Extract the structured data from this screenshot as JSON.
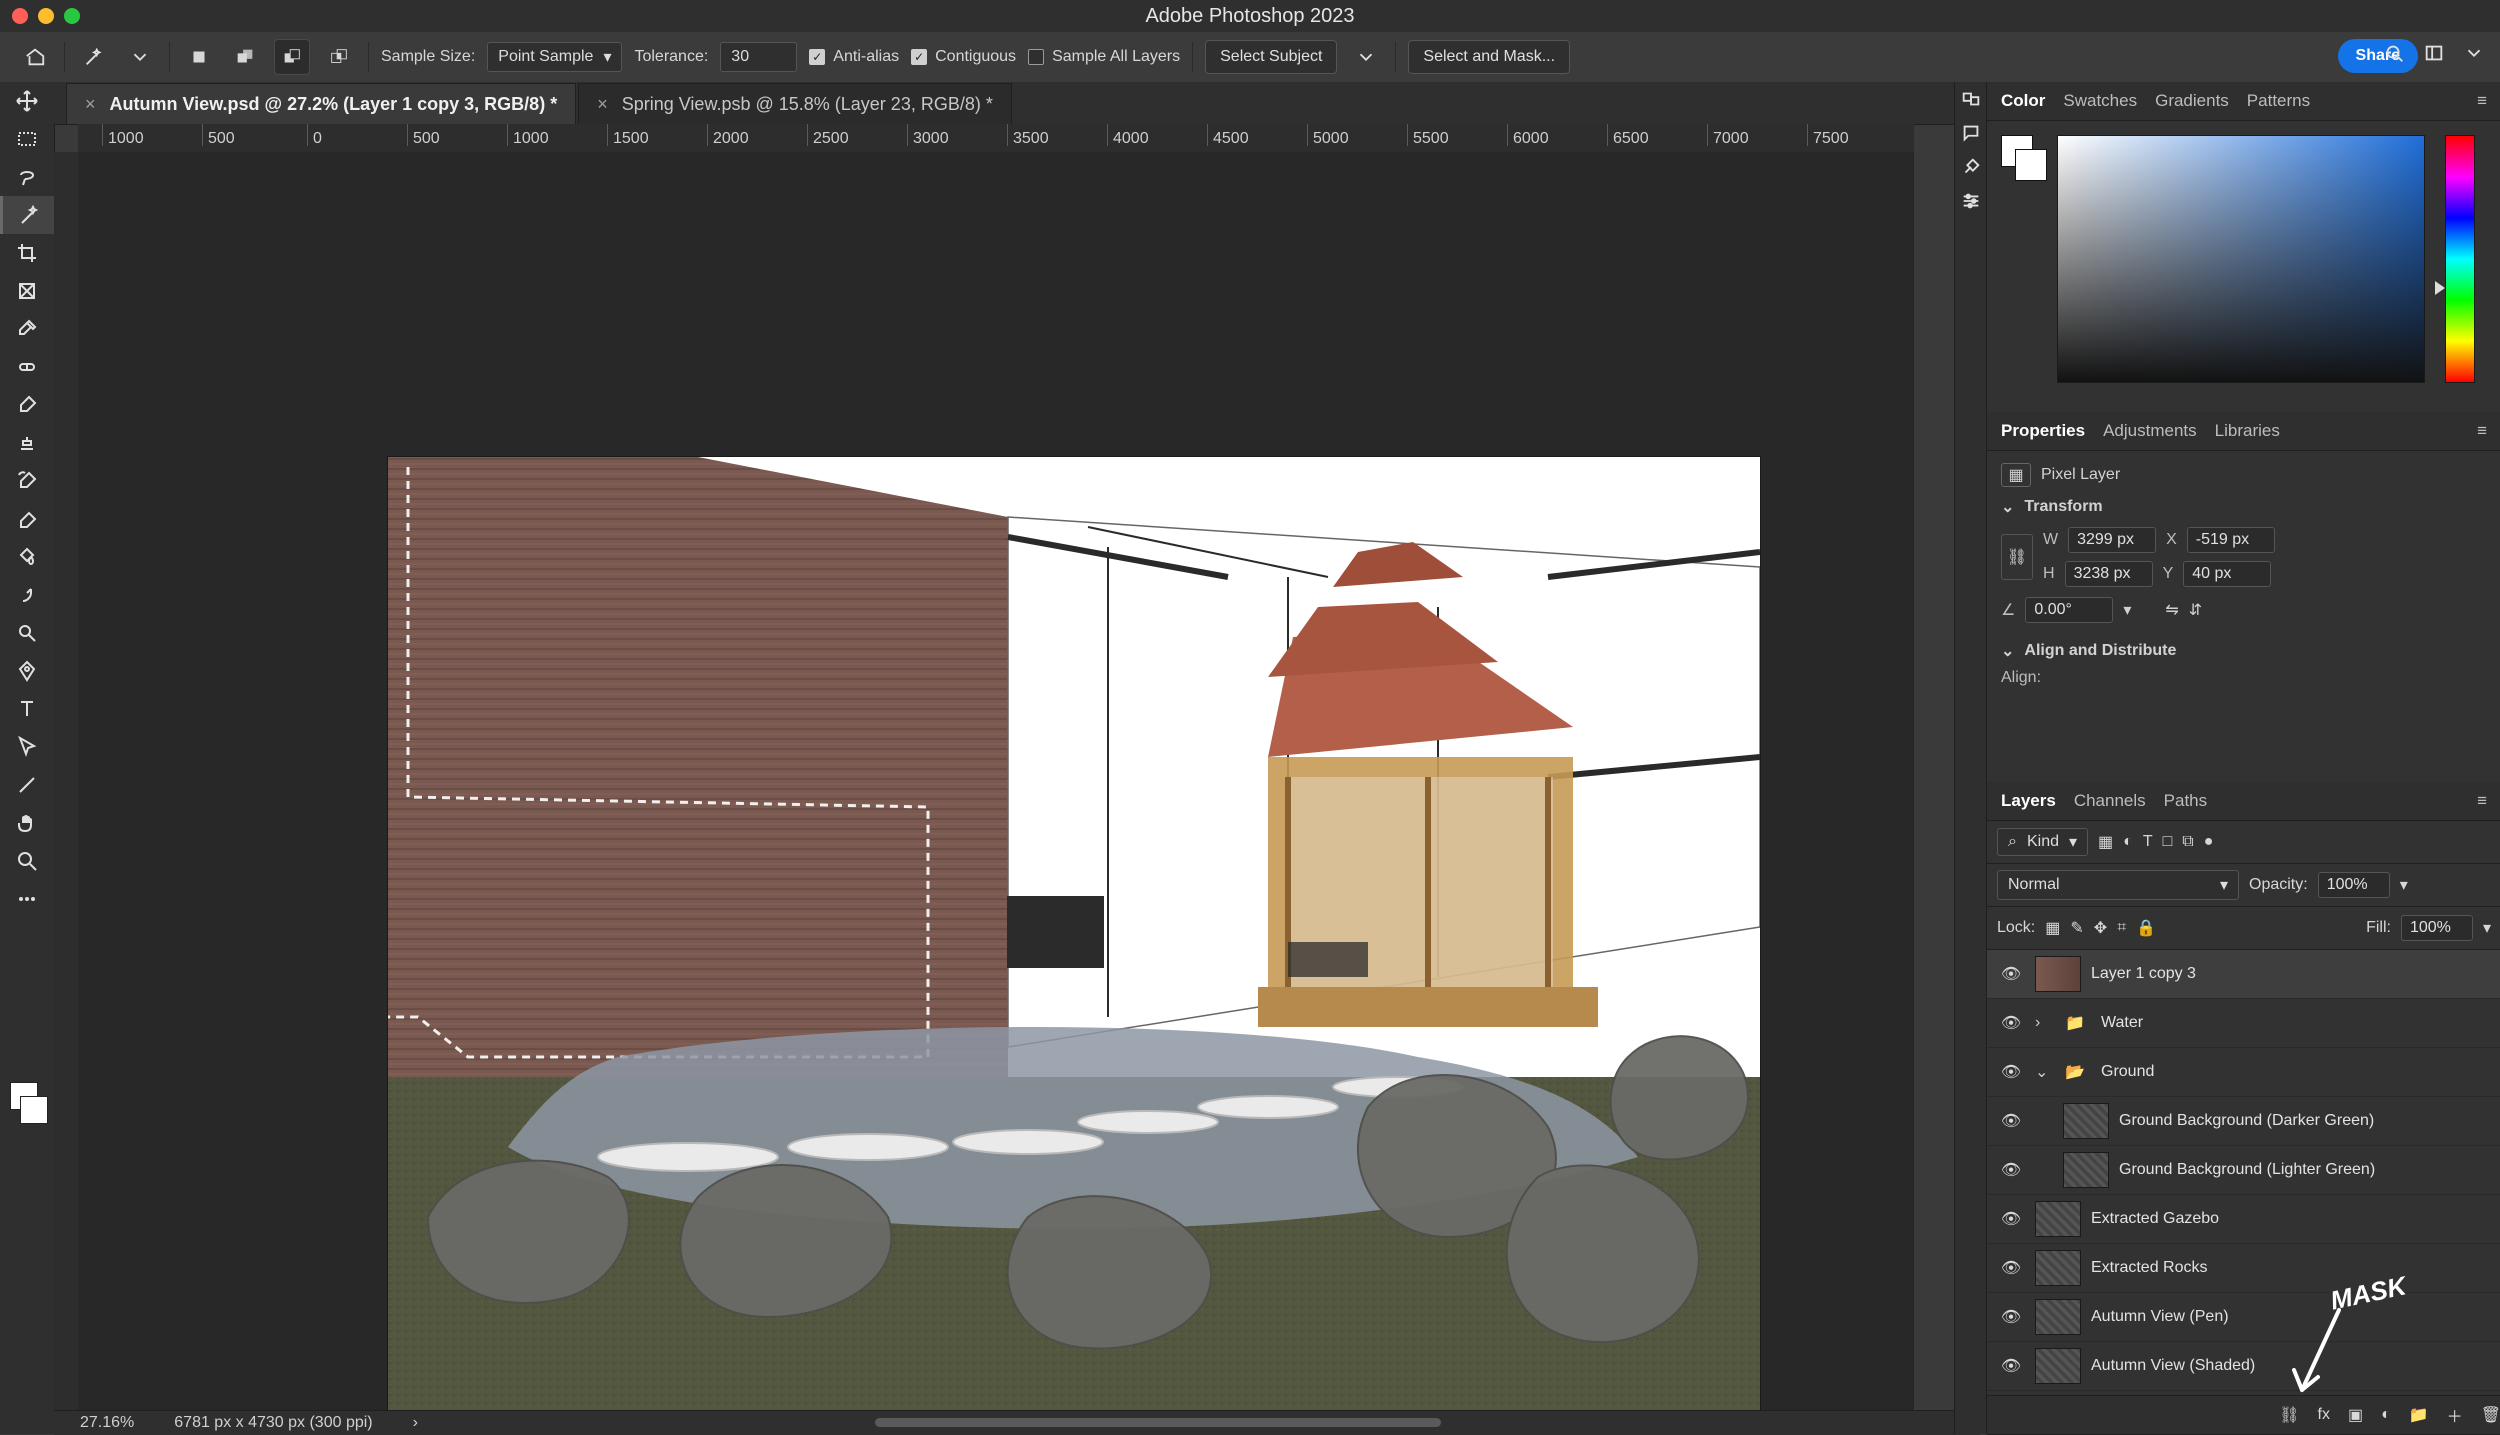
{
  "window": {
    "title": "Adobe Photoshop 2023"
  },
  "options_bar": {
    "sample_size_label": "Sample Size:",
    "sample_size_value": "Point Sample",
    "tolerance_label": "Tolerance:",
    "tolerance_value": "30",
    "anti_alias_label": "Anti-alias",
    "contiguous_label": "Contiguous",
    "sample_all_layers_label": "Sample All Layers",
    "select_subject_label": "Select Subject",
    "select_and_mask_label": "Select and Mask...",
    "share_label": "Share"
  },
  "tabs": [
    {
      "label": "Autumn View.psd @ 27.2% (Layer 1 copy 3, RGB/8) *",
      "active": true
    },
    {
      "label": "Spring View.psb @ 15.8% (Layer 23, RGB/8) *",
      "active": false
    }
  ],
  "ruler_top_labels": [
    "1000",
    "500",
    "0",
    "500",
    "1000",
    "1500",
    "2000",
    "2500",
    "3000",
    "3500",
    "4000",
    "4500",
    "5000",
    "5500",
    "6000",
    "6500",
    "7000",
    "7500"
  ],
  "status": {
    "zoom": "27.16%",
    "doc_info": "6781 px x 4730 px (300 ppi)"
  },
  "color_panel": {
    "tabs": [
      "Color",
      "Swatches",
      "Gradients",
      "Patterns"
    ]
  },
  "properties_panel": {
    "tabs": [
      "Properties",
      "Adjustments",
      "Libraries"
    ],
    "layer_type": "Pixel Layer",
    "transform_title": "Transform",
    "w": "3299 px",
    "h": "3238 px",
    "x": "-519 px",
    "y": "40 px",
    "angle": "0.00°",
    "align_title": "Align and Distribute",
    "align_label": "Align:"
  },
  "layers_panel": {
    "tabs": [
      "Layers",
      "Channels",
      "Paths"
    ],
    "filter_label": "Kind",
    "blend_mode": "Normal",
    "opacity_label": "Opacity:",
    "opacity_value": "100%",
    "lock_label": "Lock:",
    "fill_label": "Fill:",
    "fill_value": "100%",
    "layers": [
      {
        "name": "Layer 1 copy 3",
        "type": "pixel",
        "active": true,
        "thumb": "brick"
      },
      {
        "name": "Water",
        "type": "group",
        "expanded": false
      },
      {
        "name": "Ground",
        "type": "group",
        "expanded": true
      },
      {
        "name": "Ground Background (Darker Green)",
        "type": "pixel",
        "indent": true
      },
      {
        "name": "Ground Background (Lighter Green)",
        "type": "pixel",
        "indent": true
      },
      {
        "name": "Extracted Gazebo",
        "type": "pixel"
      },
      {
        "name": "Extracted Rocks",
        "type": "pixel"
      },
      {
        "name": "Autumn View (Pen)",
        "type": "pixel"
      },
      {
        "name": "Autumn View (Shaded)",
        "type": "pixel"
      }
    ],
    "annotation": "MASK"
  }
}
